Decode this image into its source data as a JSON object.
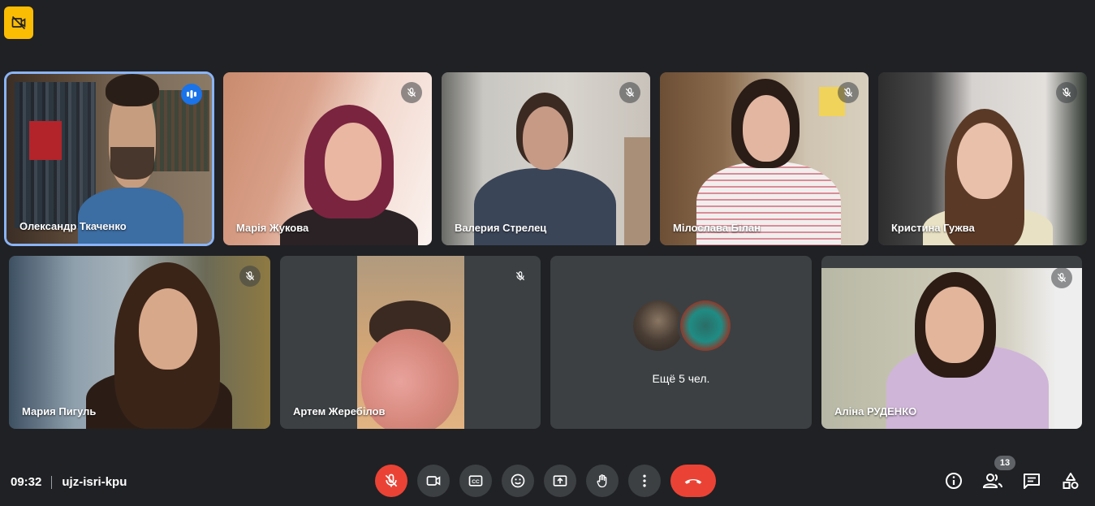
{
  "meeting": {
    "time": "09:32",
    "code": "ujz-isri-kpu"
  },
  "participants": [
    {
      "name": "Олександр Ткаченко"
    },
    {
      "name": "Марія Жукова"
    },
    {
      "name": "Валерия Стрелец"
    },
    {
      "name": "Мілослава Білан"
    },
    {
      "name": "Кристина Гужва"
    },
    {
      "name": "Мария Пигуль"
    },
    {
      "name": "Артем Жеребілов"
    },
    {
      "name": "Аліна РУДЕНКО"
    }
  ],
  "others": {
    "label": "Ещё 5 чел."
  },
  "people_count": "13",
  "icons": {
    "top": "camera-off-icon",
    "controls": [
      "mic-off-icon",
      "camera-icon",
      "captions-icon",
      "emoji-icon",
      "present-icon",
      "raise-hand-icon",
      "more-icon",
      "hang-up-icon"
    ],
    "right": [
      "info-icon",
      "people-icon",
      "chat-icon",
      "activities-icon"
    ]
  },
  "colors": {
    "accent": "#8ab4f8",
    "danger": "#ea4335",
    "warning": "#fbbc04",
    "background": "#202124"
  }
}
